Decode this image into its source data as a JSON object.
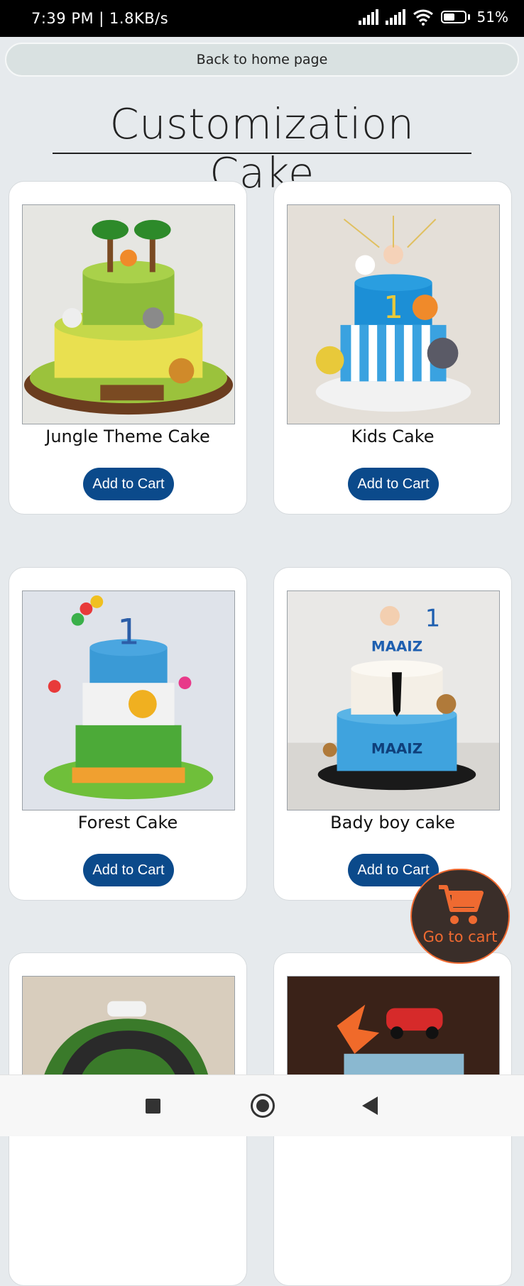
{
  "status_bar": {
    "time": "7:39 PM | 1.8KB/s",
    "battery": "51%"
  },
  "header": {
    "back_label": "Back to home page",
    "title": "Customization Cake"
  },
  "products": [
    {
      "name": "Jungle Theme Cake",
      "button": "Add to Cart",
      "image": "jungle-cake-photo"
    },
    {
      "name": "Kids Cake",
      "button": "Add to Cart",
      "image": "kids-cake-photo"
    },
    {
      "name": "Forest Cake",
      "button": "Add to Cart",
      "image": "forest-cake-photo"
    },
    {
      "name": "Bady boy cake",
      "button": "Add to Cart",
      "image": "baby-boss-cake-photo"
    }
  ],
  "floating_cart": {
    "label": "Go to cart",
    "icon": "shopping-cart-icon",
    "color": "#ef6a31"
  },
  "colors": {
    "button": "#0b4a8b",
    "background": "#e6eaed"
  },
  "nav": {
    "icons": [
      "recents-icon",
      "home-icon",
      "back-icon"
    ]
  }
}
